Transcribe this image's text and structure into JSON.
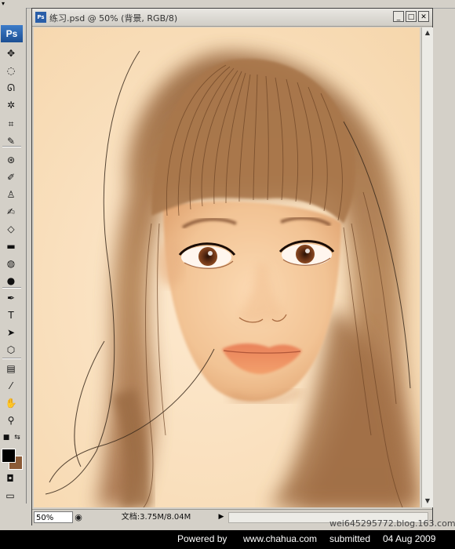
{
  "document": {
    "title": "练习.psd @ 50% (背景, RGB/8)",
    "icon_label": "Ps",
    "zoom": "50%",
    "doc_info": "文档:3.75M/8.04M"
  },
  "window_buttons": {
    "minimize": "_",
    "maximize": "□",
    "close": "✕"
  },
  "toolbox": {
    "logo": "Ps",
    "tools": [
      {
        "name": "move-tool-icon",
        "glyph": "✥"
      },
      {
        "name": "marquee-tool-icon",
        "glyph": "◌"
      },
      {
        "name": "lasso-tool-icon",
        "glyph": "ᘏ"
      },
      {
        "name": "magic-wand-tool-icon",
        "glyph": "✲"
      },
      {
        "name": "crop-tool-icon",
        "glyph": "⌗"
      },
      {
        "name": "slice-tool-icon",
        "glyph": "✎"
      },
      {
        "name": "healing-brush-tool-icon",
        "glyph": "⊛"
      },
      {
        "name": "brush-tool-icon",
        "glyph": "✐"
      },
      {
        "name": "clone-stamp-tool-icon",
        "glyph": "♙"
      },
      {
        "name": "history-brush-tool-icon",
        "glyph": "✍"
      },
      {
        "name": "eraser-tool-icon",
        "glyph": "◇"
      },
      {
        "name": "gradient-tool-icon",
        "glyph": "▬"
      },
      {
        "name": "blur-tool-icon",
        "glyph": "◍"
      },
      {
        "name": "dodge-tool-icon",
        "glyph": "●"
      },
      {
        "name": "pen-tool-icon",
        "glyph": "✒"
      },
      {
        "name": "type-tool-icon",
        "glyph": "T"
      },
      {
        "name": "path-selection-tool-icon",
        "glyph": "➤"
      },
      {
        "name": "shape-tool-icon",
        "glyph": "⬡"
      },
      {
        "name": "notes-tool-icon",
        "glyph": "▤"
      },
      {
        "name": "eyedropper-tool-icon",
        "glyph": "⁄"
      },
      {
        "name": "hand-tool-icon",
        "glyph": "✋"
      },
      {
        "name": "zoom-tool-icon",
        "glyph": "⚲"
      }
    ],
    "foreground_color": "#000000",
    "background_color": "#8b5a36"
  },
  "watermark_email": "wei645295772.blog.163.com",
  "footer": {
    "powered_by": "Powered by",
    "site": "www.chahua.com",
    "submitted_label": "submitted",
    "date": "04 Aug 2009"
  },
  "colors": {
    "canvas_background": "#fbe3c3",
    "hair_brown": "#a8784e",
    "ui_gray": "#d4d0c8"
  }
}
